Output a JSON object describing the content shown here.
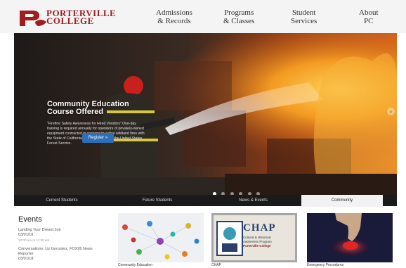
{
  "logo": {
    "line1": "PORTERVILLE",
    "line2": "COLLEGE"
  },
  "nav": [
    {
      "line1": "Admissions",
      "line2": "& Records"
    },
    {
      "line1": "Programs",
      "line2": "& Classes"
    },
    {
      "line1": "Student",
      "line2": "Services"
    },
    {
      "line1": "About",
      "line2": "PC"
    }
  ],
  "hero": {
    "title_line1": "Community Education",
    "title_line2": "Course Offered",
    "body": "\"Firefine Safety Awareness for Hired Vendors\" One-day training is required annually for operators of privately-owned equipment contracted to respond to active wildland fires with the State of California (CAL FIRE) and/or the United States Forest Service.",
    "register_label": "Register »",
    "next_arrow": "›",
    "slide_count": 6,
    "active_slide": 0
  },
  "tabs": [
    {
      "label": "Current Students"
    },
    {
      "label": "Future Students"
    },
    {
      "label": "News & Events"
    },
    {
      "label": "Community"
    }
  ],
  "events": {
    "title": "Events",
    "items": [
      {
        "title": "Landing Your Dream Job",
        "date": "03/01/18",
        "meta": "10:00 am to 11:00 am"
      },
      {
        "title": "Conversations: Liz Gonzalez, FOX26 News Reporter",
        "date": "03/01/18",
        "meta": ""
      }
    ]
  },
  "promos": [
    {
      "caption": "Community Education"
    },
    {
      "caption": "CHAP",
      "title": "CHAP",
      "sub1": "Cultural & Historical",
      "sub2": "Awareness Program",
      "college": "Porterville College"
    },
    {
      "caption": "Emergency Procedures"
    }
  ],
  "colors": {
    "brand_red": "#a11d21",
    "tab_bar": "#1a1a1a",
    "register_blue": "#2f6fb8"
  }
}
